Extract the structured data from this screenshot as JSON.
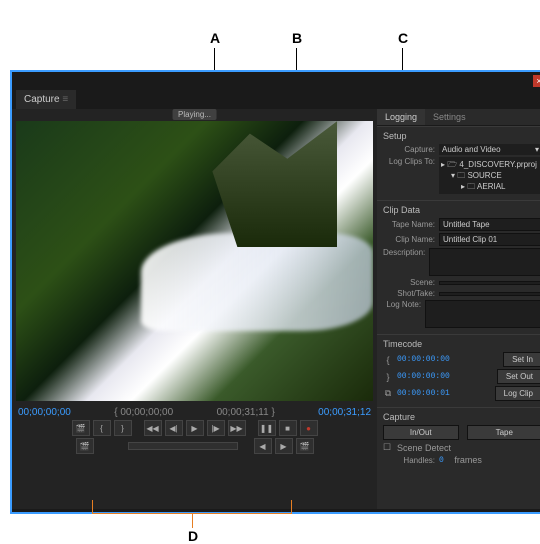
{
  "callouts": {
    "a": "A",
    "b": "B",
    "c": "C",
    "d": "D"
  },
  "window": {
    "close": "×"
  },
  "panel": {
    "tab": "Capture",
    "status": "Playing..."
  },
  "tabs": {
    "logging": "Logging",
    "settings": "Settings"
  },
  "setup": {
    "title": "Setup",
    "capture_label": "Capture:",
    "capture_value": "Audio and Video",
    "logto_label": "Log Clips To:",
    "tree": {
      "root": "4_DISCOVERY.prproj",
      "child1": "SOURCE",
      "child2": "AERIAL"
    }
  },
  "clipdata": {
    "title": "Clip Data",
    "tape_label": "Tape Name:",
    "tape_value": "Untitled Tape",
    "clip_label": "Clip Name:",
    "clip_value": "Untitled Clip 01",
    "desc_label": "Description:",
    "scene_label": "Scene:",
    "shot_label": "Shot/Take:",
    "lognote_label": "Log Note:"
  },
  "timecode": {
    "title": "Timecode",
    "in_tc": "00:00:00:00",
    "out_tc": "00:00:00:00",
    "dur_tc": "00:00:00:01",
    "setin": "Set In",
    "setout": "Set Out",
    "logclip": "Log Clip"
  },
  "capture": {
    "title": "Capture",
    "inout": "In/Out",
    "tape": "Tape",
    "scenedetect": "Scene Detect",
    "handles_label": "Handles:",
    "handles_value": "0",
    "handles_unit": "frames"
  },
  "timebar": {
    "t1": "00;00;00;00",
    "t2": "00;00;00;00",
    "t3": "00;00;31;11",
    "t4": "00;00;31;12"
  },
  "icons": {
    "brace_l": "{",
    "brace_r": "}",
    "rew": "◀◀",
    "stepb": "◀|",
    "play": "▶",
    "stepf": "|▶",
    "ff": "▶▶",
    "pause": "❚❚",
    "stop": "■",
    "rec": "●",
    "jogl": "◀",
    "jogr": "▶",
    "slate": "🎬",
    "slate2": "🎬"
  }
}
